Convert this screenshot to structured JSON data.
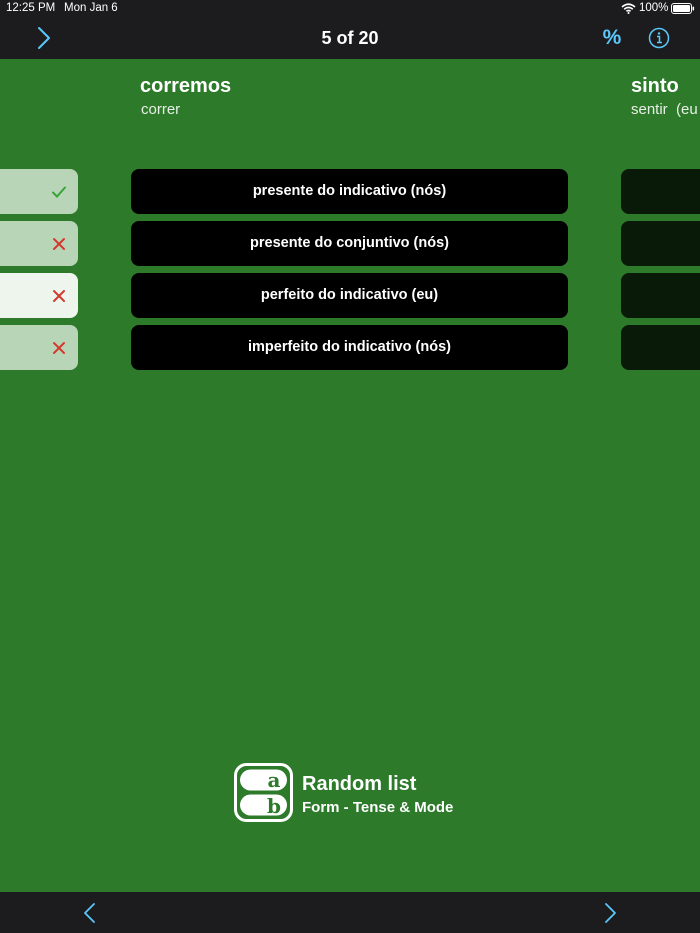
{
  "status": {
    "time": "12:25 PM",
    "date": "Mon Jan 6",
    "battery": "100%"
  },
  "nav": {
    "title": "5 of 20",
    "percent_label": "%"
  },
  "prev_card": {
    "results": [
      "correct",
      "wrong",
      "wrong",
      "wrong"
    ]
  },
  "card": {
    "word": "corremos",
    "infinitive": "correr",
    "options": [
      "presente do indicativo (nós)",
      "presente do conjuntivo (nós)",
      "perfeito do indicativo (eu)",
      "imperfeito do indicativo (nós)"
    ]
  },
  "next_card": {
    "word": "sinto",
    "infinitive": "sentir  (eu"
  },
  "branding": {
    "logo_letters": [
      "a",
      "b"
    ],
    "title": "Random list",
    "subtitle": "Form - Tense & Mode"
  },
  "colors": {
    "background": "#2d7a2a",
    "bar": "#1c1c1e",
    "accent": "#5ac8fa",
    "correct": "#3aa33a",
    "wrong": "#d23a2e"
  }
}
